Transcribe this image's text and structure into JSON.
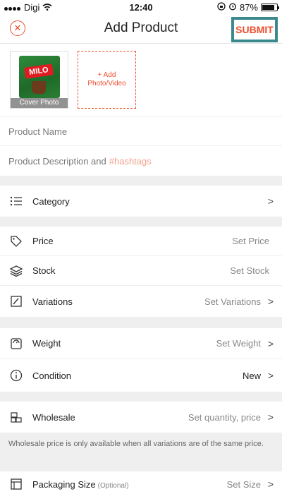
{
  "status_bar": {
    "carrier": "Digi",
    "time": "12:40",
    "battery_percent": "87%"
  },
  "header": {
    "title": "Add Product",
    "submit_label": "SUBMIT"
  },
  "media": {
    "cover_label": "Cover Photo",
    "add_label": "+ Add Photo/Video",
    "product_image_text": "MILO"
  },
  "fields": {
    "product_name_placeholder": "Product Name",
    "description_placeholder": "Product Description and",
    "hashtags": "#hashtags"
  },
  "rows": {
    "category": {
      "label": "Category"
    },
    "price": {
      "label": "Price",
      "value": "Set Price"
    },
    "stock": {
      "label": "Stock",
      "value": "Set Stock"
    },
    "variations": {
      "label": "Variations",
      "value": "Set Variations"
    },
    "weight": {
      "label": "Weight",
      "value": "Set Weight"
    },
    "condition": {
      "label": "Condition",
      "value": "New"
    },
    "wholesale": {
      "label": "Wholesale",
      "value": "Set quantity, price"
    },
    "packaging": {
      "label": "Packaging Size",
      "optional": "(Optional)",
      "value": "Set Size"
    }
  },
  "notes": {
    "wholesale": "Wholesale price is only available when all variations are of the same price."
  },
  "colors": {
    "accent": "#ee4d2d",
    "highlight_box": "#3a8a8d"
  }
}
